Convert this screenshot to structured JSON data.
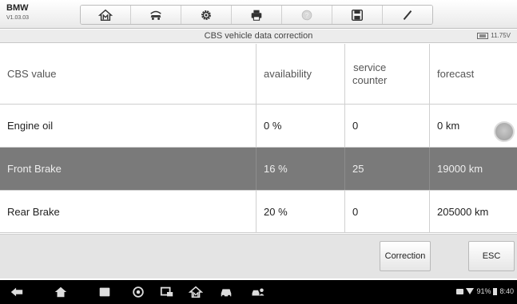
{
  "brand": {
    "name": "BMW",
    "version": "V1.03.03"
  },
  "toolbar": {
    "buttons": [
      {
        "icon": "home-icon"
      },
      {
        "icon": "vehicle-swap-icon"
      },
      {
        "icon": "gear-icon"
      },
      {
        "icon": "print-icon"
      },
      {
        "icon": "help-icon"
      },
      {
        "icon": "save-icon"
      },
      {
        "icon": "pen-icon"
      }
    ]
  },
  "title": "CBS vehicle data correction",
  "battery_voltage": "11.75V",
  "table": {
    "headers": [
      "CBS value",
      "availability",
      "service counter",
      "forecast"
    ],
    "header_counter_line1": "service",
    "header_counter_line2": "counter",
    "rows": [
      {
        "name": "Engine oil",
        "availability": "0 %",
        "counter": "0",
        "forecast": "0 km"
      },
      {
        "name": "Front Brake",
        "availability": "16 %",
        "counter": "25",
        "forecast": "19000 km"
      },
      {
        "name": "Rear Brake",
        "availability": "20 %",
        "counter": "0",
        "forecast": "205000 km"
      }
    ],
    "selected_row": 1
  },
  "actions": {
    "correction": "Correction",
    "esc": "ESC"
  },
  "statusbar": {
    "battery_pct": "91%",
    "time": "8:40"
  },
  "colors": {
    "selected_row": "#7a7a7a",
    "nav_bar": "#000000"
  }
}
